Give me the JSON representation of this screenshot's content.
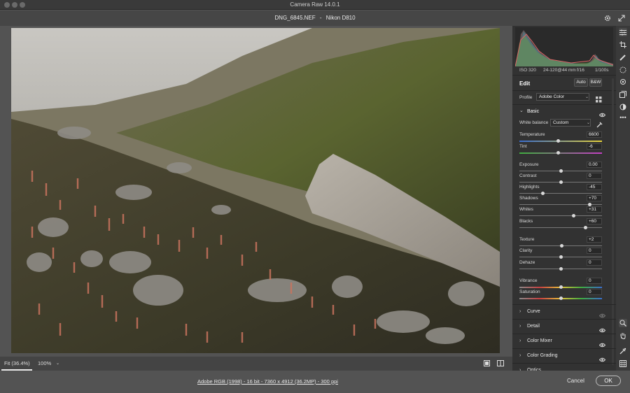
{
  "window": {
    "title": "Camera Raw 14.0.1"
  },
  "file": {
    "name": "DNG_6845.NEF",
    "separator": "-",
    "camera": "Nikon D810"
  },
  "histogram_meta": {
    "iso": "ISO 320",
    "lens": "24-120@44 mm",
    "aperture": "f/16",
    "shutter": "1/100s"
  },
  "edit": {
    "title": "Edit",
    "auto": "Auto",
    "bw": "B&W"
  },
  "profile": {
    "label": "Profile",
    "value": "Adobe Color"
  },
  "basic": {
    "title": "Basic",
    "white_balance_label": "White balance",
    "white_balance_value": "Custom",
    "sliders": [
      {
        "label": "Temperature",
        "value": "6600",
        "level": 0.47
      },
      {
        "label": "Tint",
        "value": "-6",
        "level": 0.47
      },
      {
        "label": "Exposure",
        "value": "0.00",
        "level": 0.5
      },
      {
        "label": "Contrast",
        "value": "0",
        "level": 0.5
      },
      {
        "label": "Highlights",
        "value": "-45",
        "level": 0.28
      },
      {
        "label": "Shadows",
        "value": "+70",
        "level": 0.85
      },
      {
        "label": "Whites",
        "value": "+31",
        "level": 0.66
      },
      {
        "label": "Blacks",
        "value": "+60",
        "level": 0.8
      },
      {
        "label": "Texture",
        "value": "+2",
        "level": 0.51
      },
      {
        "label": "Clarity",
        "value": "0",
        "level": 0.5
      },
      {
        "label": "Dehaze",
        "value": "0",
        "level": 0.5
      },
      {
        "label": "Vibrance",
        "value": "0",
        "level": 0.5
      },
      {
        "label": "Saturation",
        "value": "0",
        "level": 0.5
      }
    ]
  },
  "sections": [
    "Curve",
    "Detail",
    "Color Mixer",
    "Color Grading",
    "Optics"
  ],
  "zoom": {
    "fit": "Fit (36.4%)",
    "percent": "100%"
  },
  "footer": {
    "info": "Adobe RGB (1998) - 16 bit - 7360 x 4912 (36.2MP) - 300 ppi",
    "cancel": "Cancel",
    "ok": "OK"
  },
  "colors": {
    "panel": "#323232",
    "background": "#535353",
    "accent": "#e8e8e8"
  },
  "icons": [
    "settings-icon",
    "expand-icon",
    "edit-sliders-icon",
    "crop-icon",
    "brush-icon",
    "redeye-icon",
    "mask-icon",
    "presets-icon",
    "snapshot-icon",
    "more-icon",
    "zoom-icon",
    "hand-icon",
    "sampler-icon",
    "grid-icon",
    "eyedropper-icon",
    "eye-icon",
    "chevron-down-icon",
    "chevron-right-icon"
  ]
}
